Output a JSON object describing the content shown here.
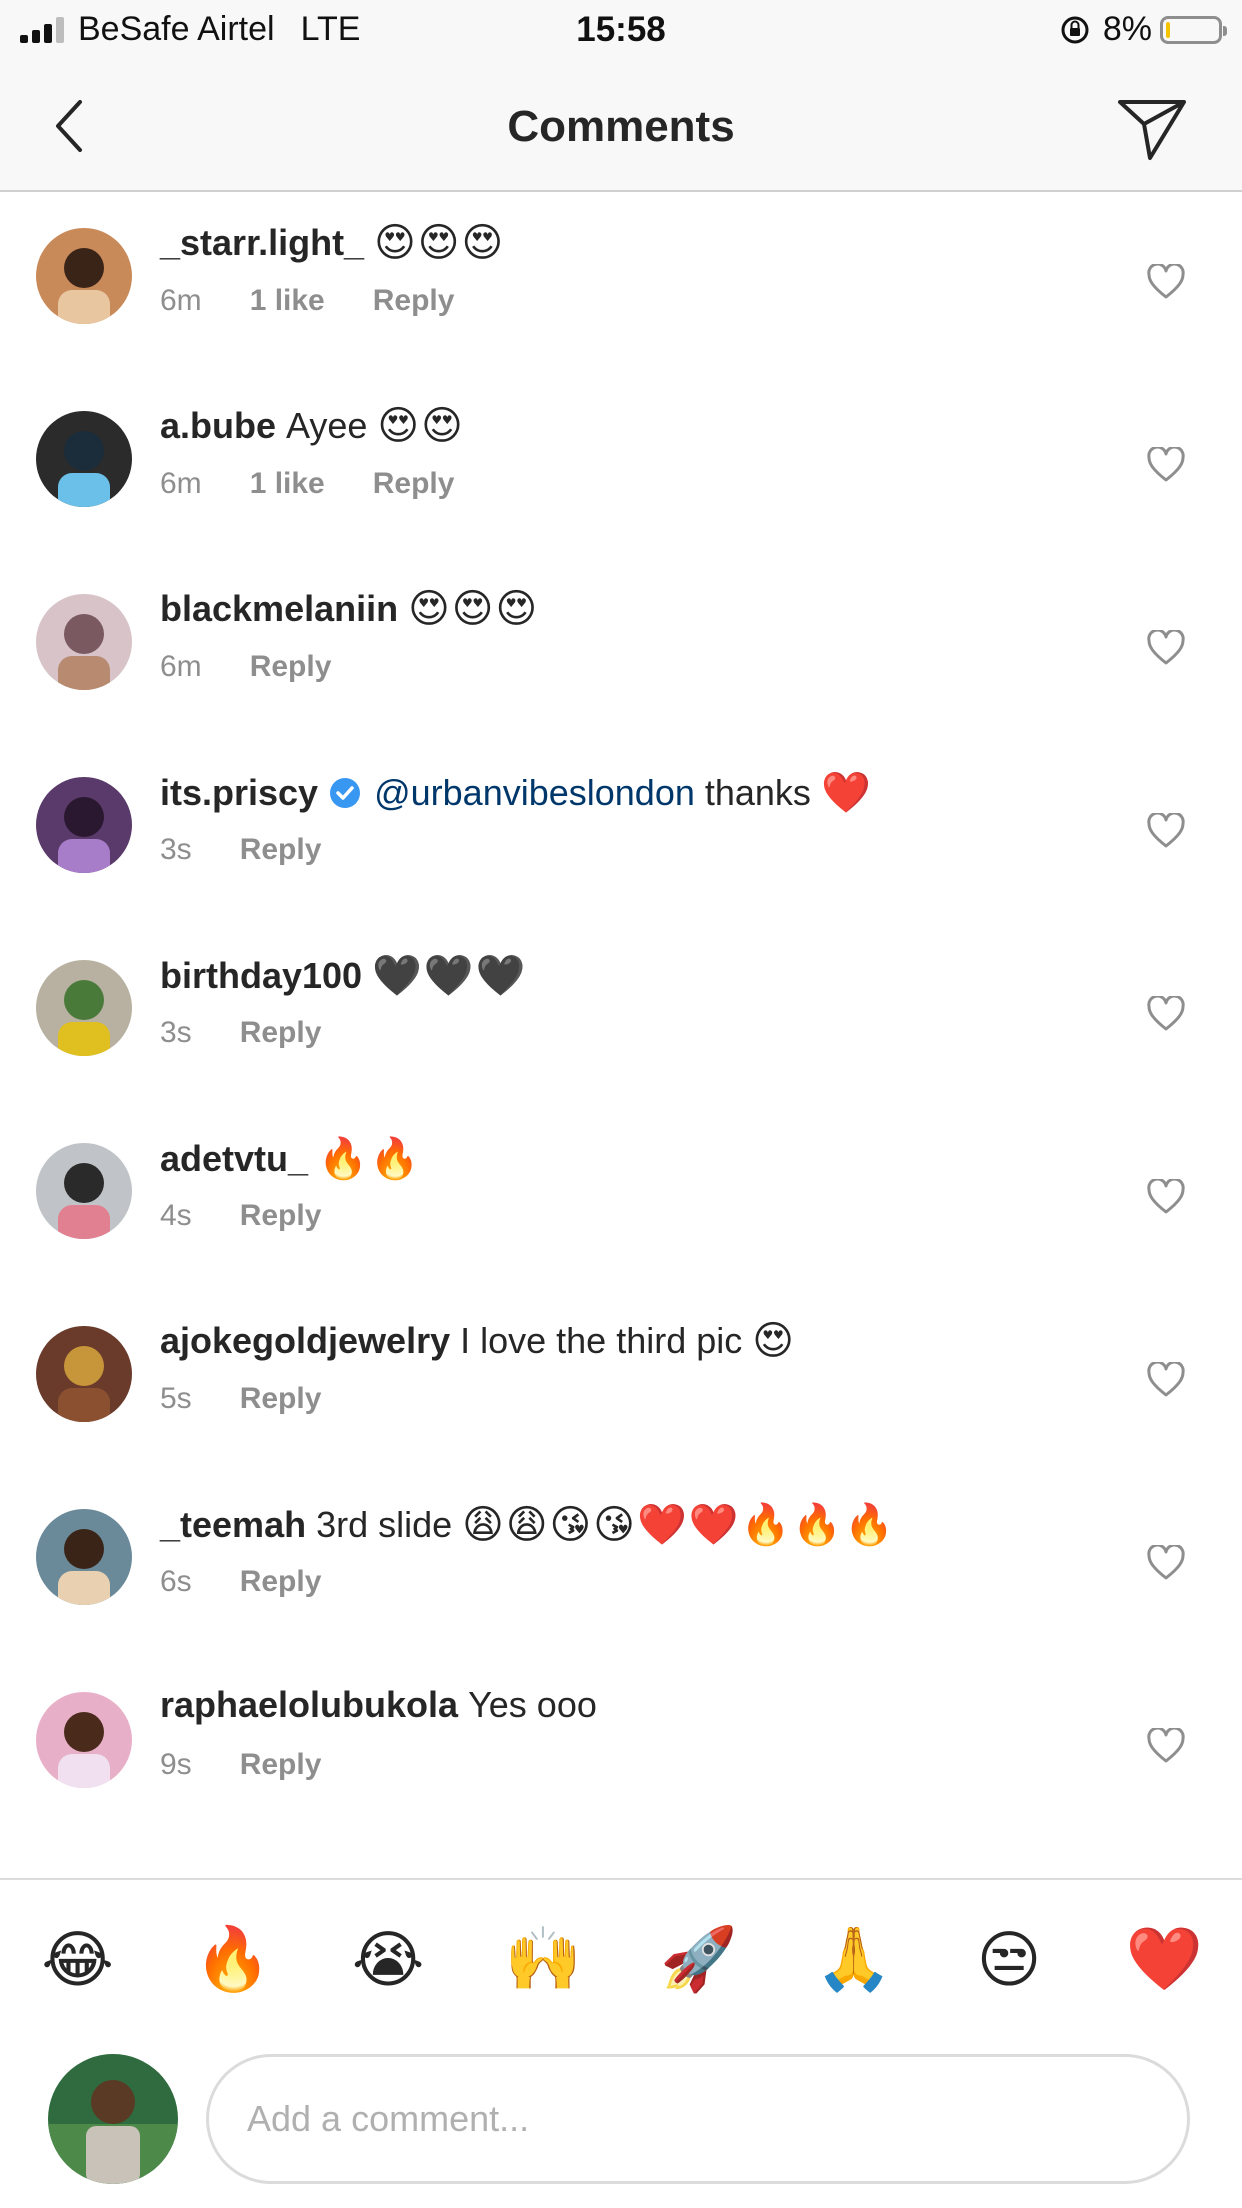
{
  "status_bar": {
    "carrier": "BeSafe Airtel",
    "network": "LTE",
    "time": "15:58",
    "battery_text": "8%",
    "battery_level": 0.08
  },
  "nav": {
    "title": "Comments",
    "back_icon": "chevron-left-icon",
    "send_icon": "paper-plane-icon"
  },
  "comments": [
    {
      "username": "_starr.light_",
      "text": "",
      "emojis": "😍😍😍",
      "time": "6m",
      "likes": "1 like",
      "reply": "Reply"
    },
    {
      "username": "a.bube",
      "text": "Ayee",
      "emojis": "😍😍",
      "time": "6m",
      "likes": "1 like",
      "reply": "Reply"
    },
    {
      "username": "blackmelaniin",
      "text": "",
      "emojis": "😍😍😍",
      "time": "6m",
      "likes": "",
      "reply": "Reply"
    },
    {
      "username": "its.priscy",
      "verified": true,
      "mention": "@urbanvibeslondon",
      "text": "thanks",
      "emojis": "❤️",
      "time": "3s",
      "likes": "",
      "reply": "Reply"
    },
    {
      "username": "birthday100",
      "text": "",
      "emojis": "🖤🖤🖤",
      "time": "3s",
      "likes": "",
      "reply": "Reply"
    },
    {
      "username": "adetvtu_",
      "text": "",
      "emojis": "🔥🔥",
      "time": "4s",
      "likes": "",
      "reply": "Reply"
    },
    {
      "username": "ajokegoldjewelry",
      "text": "I love the third pic",
      "emojis": "😍",
      "time": "5s",
      "likes": "",
      "reply": "Reply"
    },
    {
      "username": "_teemah",
      "text": "3rd slide",
      "emojis": "😩😩😘😘❤️❤️🔥🔥🔥",
      "time": "6s",
      "likes": "",
      "reply": "Reply"
    },
    {
      "username": "raphaelolubukola",
      "text": "Yes ooo",
      "emojis": "",
      "time": "9s",
      "likes": "",
      "reply": "Reply"
    }
  ],
  "emoji_bar": [
    "😂",
    "🔥",
    "😭",
    "🙌",
    "🚀",
    "🙏",
    "😒",
    "❤️"
  ],
  "composer": {
    "placeholder": "Add a comment..."
  },
  "colors": {
    "link": "#00376b",
    "muted": "#8e8e8e",
    "verified": "#3897f0",
    "battery_fill": "#f5c400"
  }
}
